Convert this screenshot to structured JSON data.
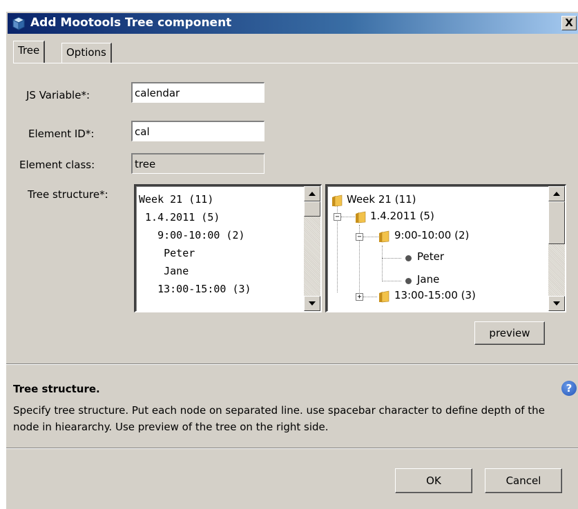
{
  "window": {
    "title": "Add Mootools Tree component",
    "close_glyph": "X"
  },
  "tabs": [
    {
      "label": "Tree",
      "active": true
    },
    {
      "label": "Options",
      "active": false
    }
  ],
  "form": {
    "js_variable": {
      "label": "JS Variable*:",
      "value": "calendar"
    },
    "element_id": {
      "label": "Element ID*:",
      "value": "cal"
    },
    "element_class": {
      "label": "Element class:",
      "value": "tree"
    },
    "tree_structure": {
      "label": "Tree structure*:",
      "lines": [
        "Week 21 (11)",
        " 1.4.2011 (5)",
        "   9:00-10:00 (2)",
        "    Peter",
        "    Jane",
        "   13:00-15:00 (3)"
      ]
    }
  },
  "tree_preview": {
    "nodes": [
      {
        "label": "Week 21 (11)",
        "type": "folder",
        "expander": ""
      },
      {
        "label": "1.4.2011 (5)",
        "type": "folder",
        "expander": "−"
      },
      {
        "label": "9:00-10:00 (2)",
        "type": "folder",
        "expander": "−"
      },
      {
        "label": "Peter",
        "type": "leaf",
        "expander": ""
      },
      {
        "label": "Jane",
        "type": "leaf",
        "expander": ""
      },
      {
        "label": "13:00-15:00 (3)",
        "type": "folder",
        "expander": "+"
      }
    ]
  },
  "preview_button": "preview",
  "help": {
    "title": "Tree structure.",
    "text": "Specify tree structure. Put each node on separated line. use spacebar character to define depth of the node in hieararchy. Use preview of the tree on the right side.",
    "icon_glyph": "?"
  },
  "buttons": {
    "ok": "OK",
    "cancel": "Cancel"
  },
  "colors": {
    "dialog_bg": "#d4d0c8",
    "titlebar_start": "#0a246a",
    "titlebar_end": "#a6caf0",
    "folder": "#f2c24a"
  }
}
